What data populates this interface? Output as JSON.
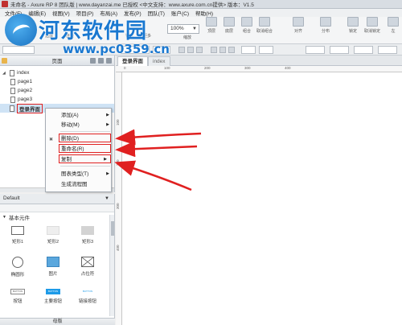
{
  "window": {
    "title": "未命名 - Axure RP 8 团队版 | www.dayanzai.me 已授权 <中文支持：www.axure.com.cn提供> 版本：V1.5"
  },
  "menubar": {
    "items": [
      {
        "label": "文件(F)"
      },
      {
        "label": "编辑(E)"
      },
      {
        "label": "视图(V)"
      },
      {
        "label": "项目(P)"
      },
      {
        "label": "布局(A)"
      },
      {
        "label": "发布(P)"
      },
      {
        "label": "团队(T)"
      },
      {
        "label": "账户(C)"
      },
      {
        "label": "帮助(H)"
      }
    ]
  },
  "watermark": {
    "name": "河东软件园",
    "url": "www.pc0359.cn"
  },
  "toolbar": {
    "zoom": "100%",
    "buttons": [
      {
        "label": "选择"
      },
      {
        "label": "连接"
      },
      {
        "label": "钢笔"
      },
      {
        "label": "更多"
      },
      {
        "label": "缩放"
      },
      {
        "label": "顶层"
      },
      {
        "label": "底层"
      },
      {
        "label": "组合"
      },
      {
        "label": "取消组合"
      },
      {
        "label": "对齐"
      },
      {
        "label": "分布"
      },
      {
        "label": "锁定"
      },
      {
        "label": "取消锁定"
      },
      {
        "label": "左"
      }
    ]
  },
  "pages_panel": {
    "title": "页面",
    "tree": [
      {
        "label": "index",
        "level": 0,
        "expanded": true
      },
      {
        "label": "page1",
        "level": 1
      },
      {
        "label": "page2",
        "level": 1
      },
      {
        "label": "page3",
        "level": 1
      },
      {
        "label": "登录界面",
        "level": 0,
        "selected": true
      }
    ]
  },
  "context_menu": {
    "items": [
      {
        "label": "添加(A)",
        "submenu": true
      },
      {
        "label": "移动(M)",
        "submenu": true
      },
      {
        "label": "删除(D)",
        "highlighted": true
      },
      {
        "label": "重命名(R)",
        "highlighted": true
      },
      {
        "label": "复制",
        "submenu": true,
        "highlighted": true
      },
      {
        "label": "图表类型(T)",
        "submenu": true
      },
      {
        "label": "生成流程图"
      }
    ]
  },
  "widgets_panel": {
    "library": "Default",
    "category": "基本元件",
    "items": [
      {
        "label": "矩形1",
        "icon": "rect-outline-icon"
      },
      {
        "label": "矩形2",
        "icon": "rect-light-icon"
      },
      {
        "label": "矩形3",
        "icon": "rect-gray-icon"
      },
      {
        "label": "椭圆形",
        "icon": "ellipse-icon"
      },
      {
        "label": "图片",
        "icon": "image-icon"
      },
      {
        "label": "占位符",
        "icon": "placeholder-icon"
      },
      {
        "label": "按钮",
        "icon": "button-icon",
        "text": "BUTTON"
      },
      {
        "label": "主要按钮",
        "icon": "primary-button-icon",
        "text": "BUTTON"
      },
      {
        "label": "链接按钮",
        "icon": "link-button-icon",
        "text": "BUTTON"
      }
    ],
    "bottom_tab": "母版"
  },
  "doc_tabs": [
    {
      "label": "登录界面",
      "active": true
    },
    {
      "label": "index",
      "active": false
    }
  ],
  "rulers": {
    "h_ticks": [
      "0",
      "100",
      "200",
      "300",
      "400"
    ],
    "v_ticks": [
      "100",
      "200",
      "300",
      "400"
    ]
  },
  "colors": {
    "highlight": "#e02020",
    "selection": "#cfe3f5",
    "watermark": "#1a78d0"
  }
}
